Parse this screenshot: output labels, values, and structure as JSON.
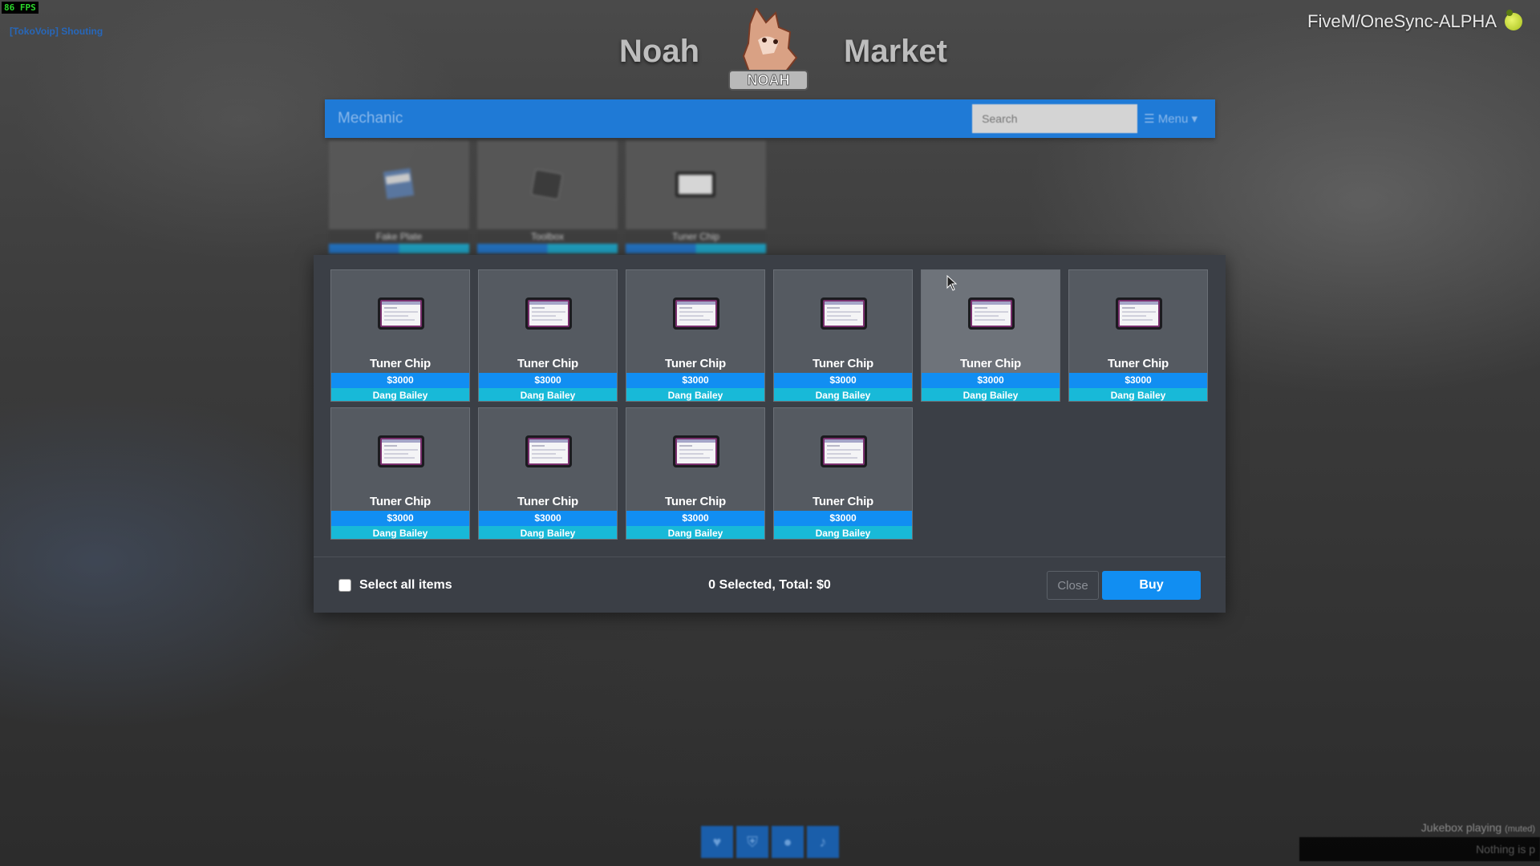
{
  "hud": {
    "fps": "86 FPS",
    "voice_status": "[TokoVoip] Shouting",
    "server_name": "FiveM/OneSync-ALPHA",
    "server_logo_icon": "lemon-icon"
  },
  "brand": {
    "left_word": "Noah",
    "right_word": "Market",
    "logo_icon": "fox-mascot-logo"
  },
  "navbar": {
    "title": "Mechanic",
    "search_placeholder": "Search",
    "menu_label": "☰ Menu ▾",
    "color": "#1f7ad6"
  },
  "categories": [
    {
      "label": "Fake Plate",
      "icon": "license-plate-icon"
    },
    {
      "label": "Toolbox",
      "icon": "toolbox-icon"
    },
    {
      "label": "Tuner Chip",
      "icon": "tablet-icon"
    }
  ],
  "items": [
    {
      "name": "Tuner Chip",
      "price": "$3000",
      "seller": "Dang Bailey",
      "icon": "tablet-icon"
    },
    {
      "name": "Tuner Chip",
      "price": "$3000",
      "seller": "Dang Bailey",
      "icon": "tablet-icon"
    },
    {
      "name": "Tuner Chip",
      "price": "$3000",
      "seller": "Dang Bailey",
      "icon": "tablet-icon"
    },
    {
      "name": "Tuner Chip",
      "price": "$3000",
      "seller": "Dang Bailey",
      "icon": "tablet-icon"
    },
    {
      "name": "Tuner Chip",
      "price": "$3000",
      "seller": "Dang Bailey",
      "icon": "tablet-icon"
    },
    {
      "name": "Tuner Chip",
      "price": "$3000",
      "seller": "Dang Bailey",
      "icon": "tablet-icon"
    },
    {
      "name": "Tuner Chip",
      "price": "$3000",
      "seller": "Dang Bailey",
      "icon": "tablet-icon"
    },
    {
      "name": "Tuner Chip",
      "price": "$3000",
      "seller": "Dang Bailey",
      "icon": "tablet-icon"
    },
    {
      "name": "Tuner Chip",
      "price": "$3000",
      "seller": "Dang Bailey",
      "icon": "tablet-icon"
    },
    {
      "name": "Tuner Chip",
      "price": "$3000",
      "seller": "Dang Bailey",
      "icon": "tablet-icon"
    }
  ],
  "footer": {
    "select_all_label": "Select all items",
    "summary": "0 Selected, Total: $0",
    "close_label": "Close",
    "buy_label": "Buy"
  },
  "bottom_bar": {
    "icons": [
      "heart-icon",
      "shield-icon",
      "drop-icon",
      "speaker-icon"
    ]
  },
  "jukebox": {
    "status": "Jukebox playing",
    "muted": "(muted)",
    "now_playing": "Nothing is p"
  },
  "colors": {
    "price_bar": "#118ef2",
    "seller_bar": "#18b9d8",
    "modal_bg": "#3b3f46",
    "buy_button": "#118ef2"
  }
}
